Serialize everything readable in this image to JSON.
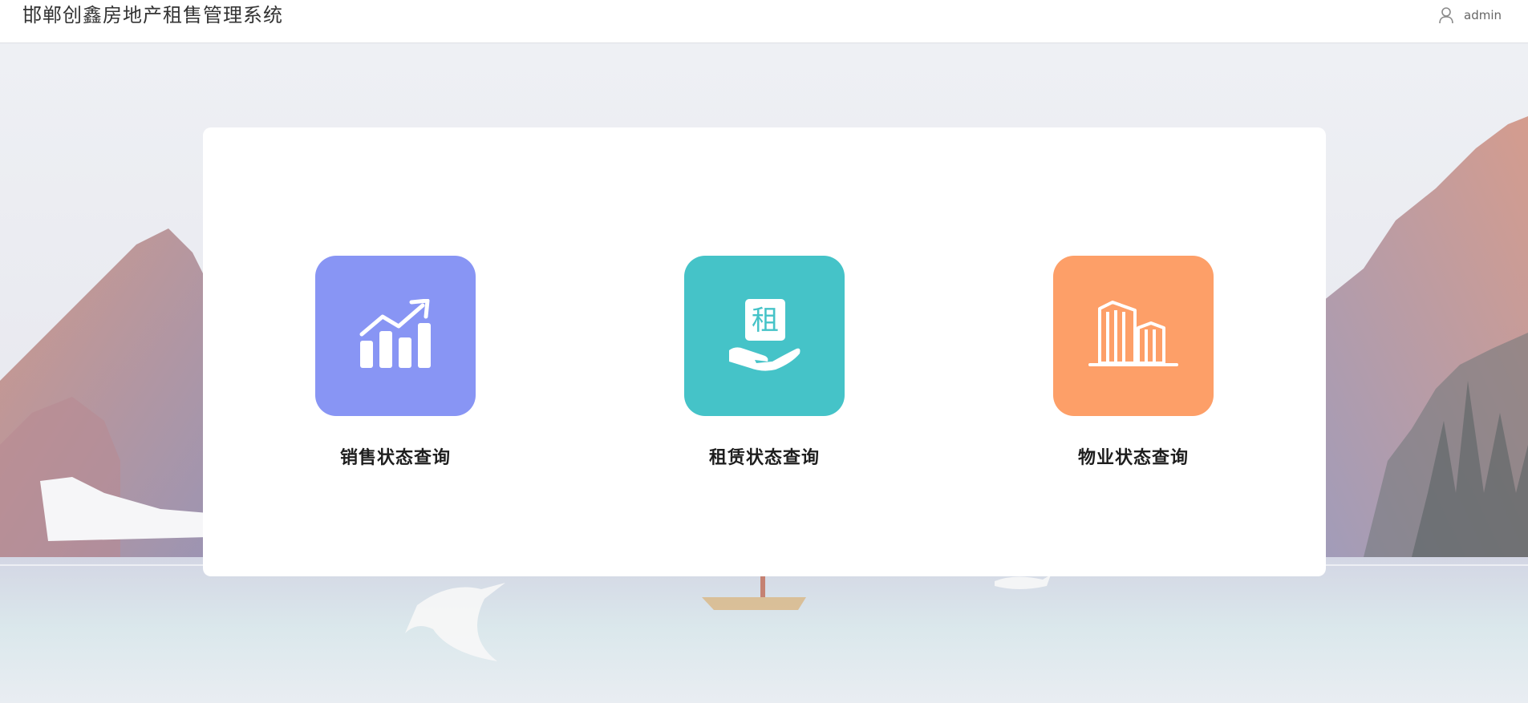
{
  "header": {
    "title": "邯郸创鑫房地产租售管理系统",
    "username": "admin"
  },
  "tiles": [
    {
      "label": "销售状态查询",
      "icon": "sales-chart-icon",
      "color": "#8895f4"
    },
    {
      "label": "租赁状态查询",
      "icon": "rent-hand-icon",
      "color": "#45c3c8",
      "glyph": "租"
    },
    {
      "label": "物业状态查询",
      "icon": "building-icon",
      "color": "#fd9f68"
    }
  ],
  "colors": {
    "card": "#ffffff",
    "topbar": "#ffffff",
    "text": "#1e1e1e"
  }
}
